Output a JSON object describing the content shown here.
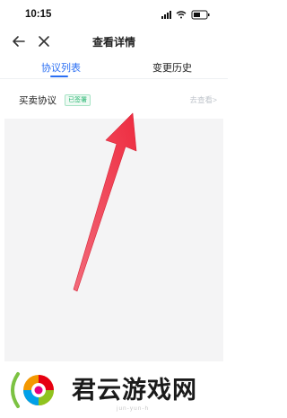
{
  "status_bar": {
    "time": "10:15",
    "icons": [
      "signal-icon",
      "wifi-icon",
      "battery-icon"
    ]
  },
  "nav": {
    "title": "查看详情",
    "back_icon": "arrow-left-icon",
    "close_icon": "close-icon"
  },
  "tabs": [
    {
      "label": "协议列表",
      "active": true
    },
    {
      "label": "变更历史",
      "active": false
    }
  ],
  "agreement": {
    "name": "买卖协议",
    "badge": "已签署",
    "link": "去查看>"
  },
  "footer": {
    "title": "君云游戏网",
    "subtitle": "jun-yun-h"
  },
  "colors": {
    "accent": "#2b6ff3",
    "badge_green": "#2bb673",
    "arrow_red": "#ee3344"
  }
}
